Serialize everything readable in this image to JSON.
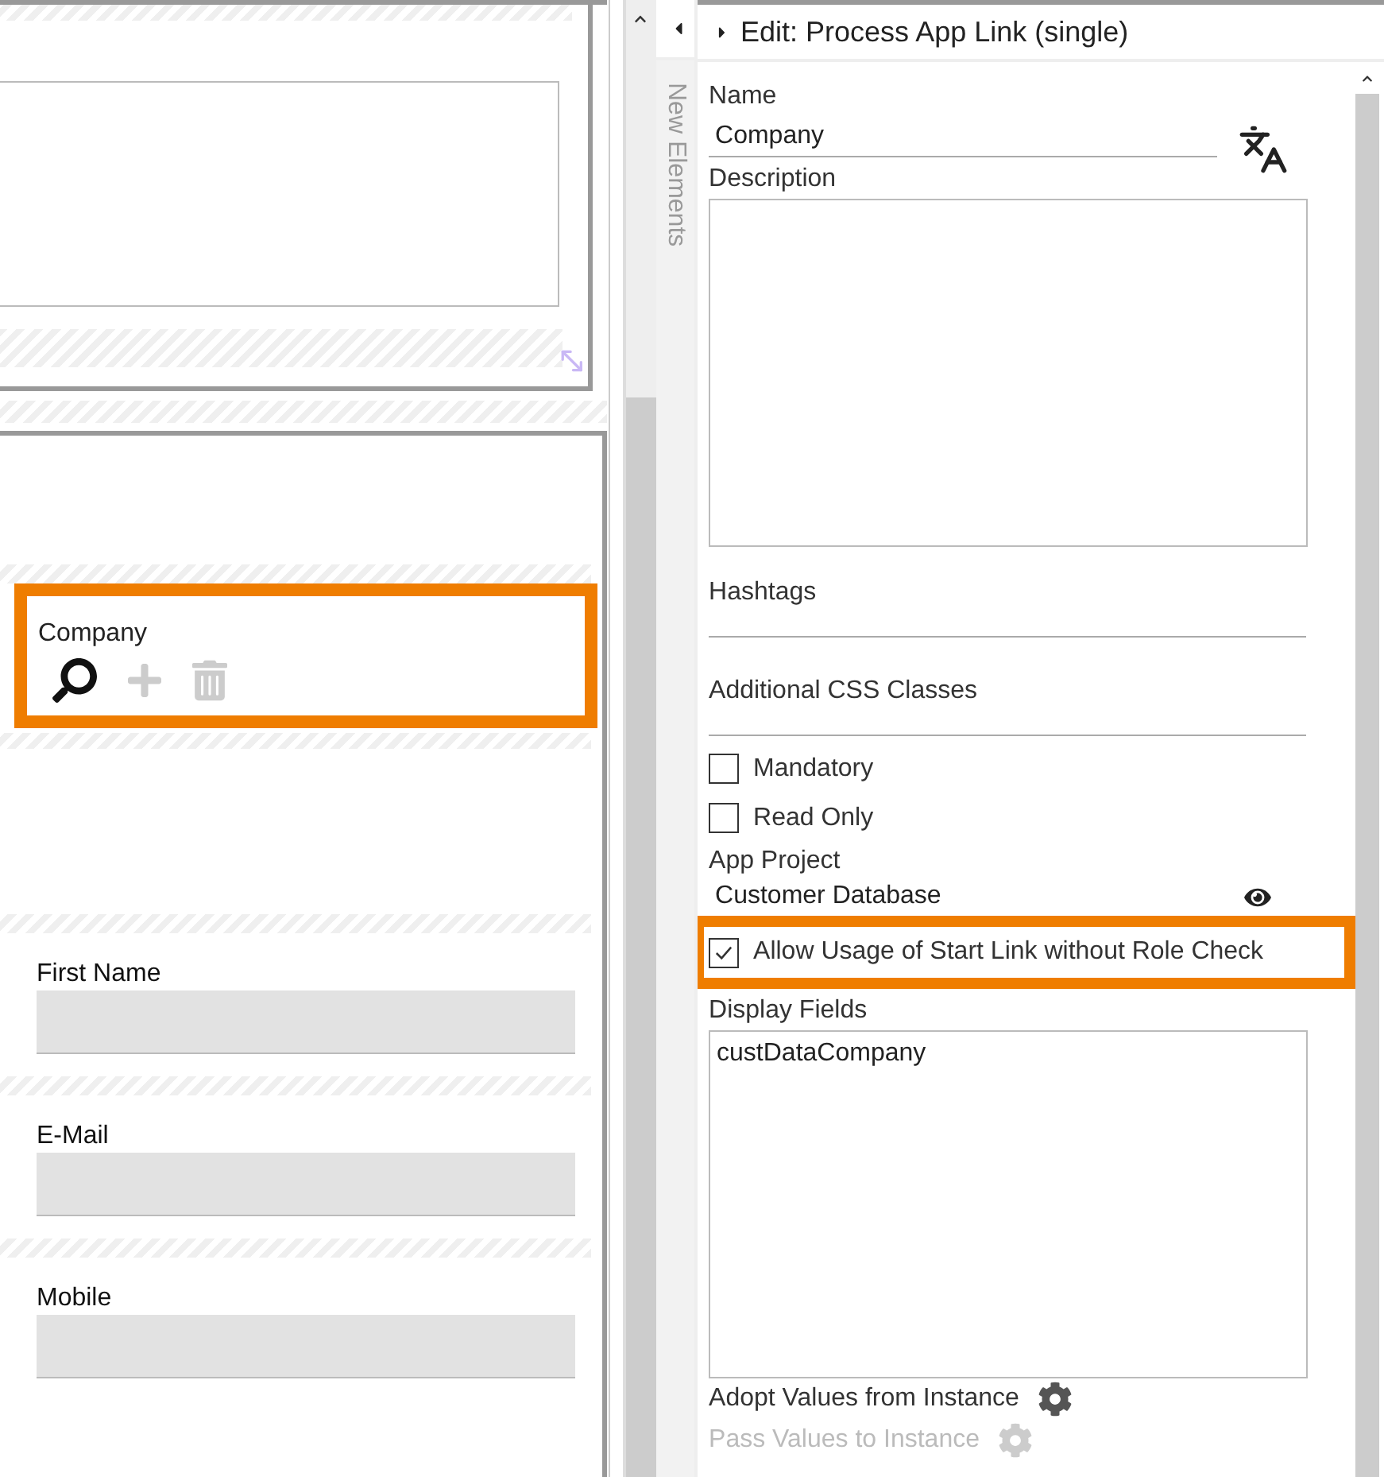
{
  "canvas": {
    "company_field": {
      "label": "Company",
      "highlighted": true,
      "actions": [
        {
          "kind": "search",
          "disabled": false
        },
        {
          "kind": "add",
          "disabled": true
        },
        {
          "kind": "delete",
          "disabled": true
        }
      ]
    },
    "fields": [
      {
        "label": "First Name"
      },
      {
        "label": "E-Mail"
      },
      {
        "label": "Mobile"
      }
    ]
  },
  "side_tab": {
    "label": "New Elements"
  },
  "panel": {
    "title": "Edit: Process App Link (single)",
    "properties": [
      {
        "kind": "text",
        "label": "Name",
        "value": "Company"
      },
      {
        "kind": "textarea",
        "label": "Description"
      },
      {
        "kind": "line",
        "label": "Hashtags"
      },
      {
        "kind": "line",
        "label": "Additional CSS Classes"
      },
      {
        "kind": "checkbox",
        "label": "Mandatory",
        "checked": false,
        "highlighted": false
      },
      {
        "kind": "checkbox",
        "label": "Read Only",
        "checked": false,
        "highlighted": false
      },
      {
        "kind": "link",
        "label": "App Project",
        "value": "Customer Database"
      },
      {
        "kind": "checkbox",
        "label": "Allow Usage of Start Link without Role Check",
        "checked": true,
        "highlighted": true
      },
      {
        "kind": "textarea",
        "label": "Display Fields",
        "value": "custDataCompany"
      },
      {
        "kind": "action",
        "label": "Adopt Values from Instance",
        "disabled": false
      },
      {
        "kind": "action",
        "label": "Pass Values to Instance",
        "disabled": true
      }
    ]
  }
}
